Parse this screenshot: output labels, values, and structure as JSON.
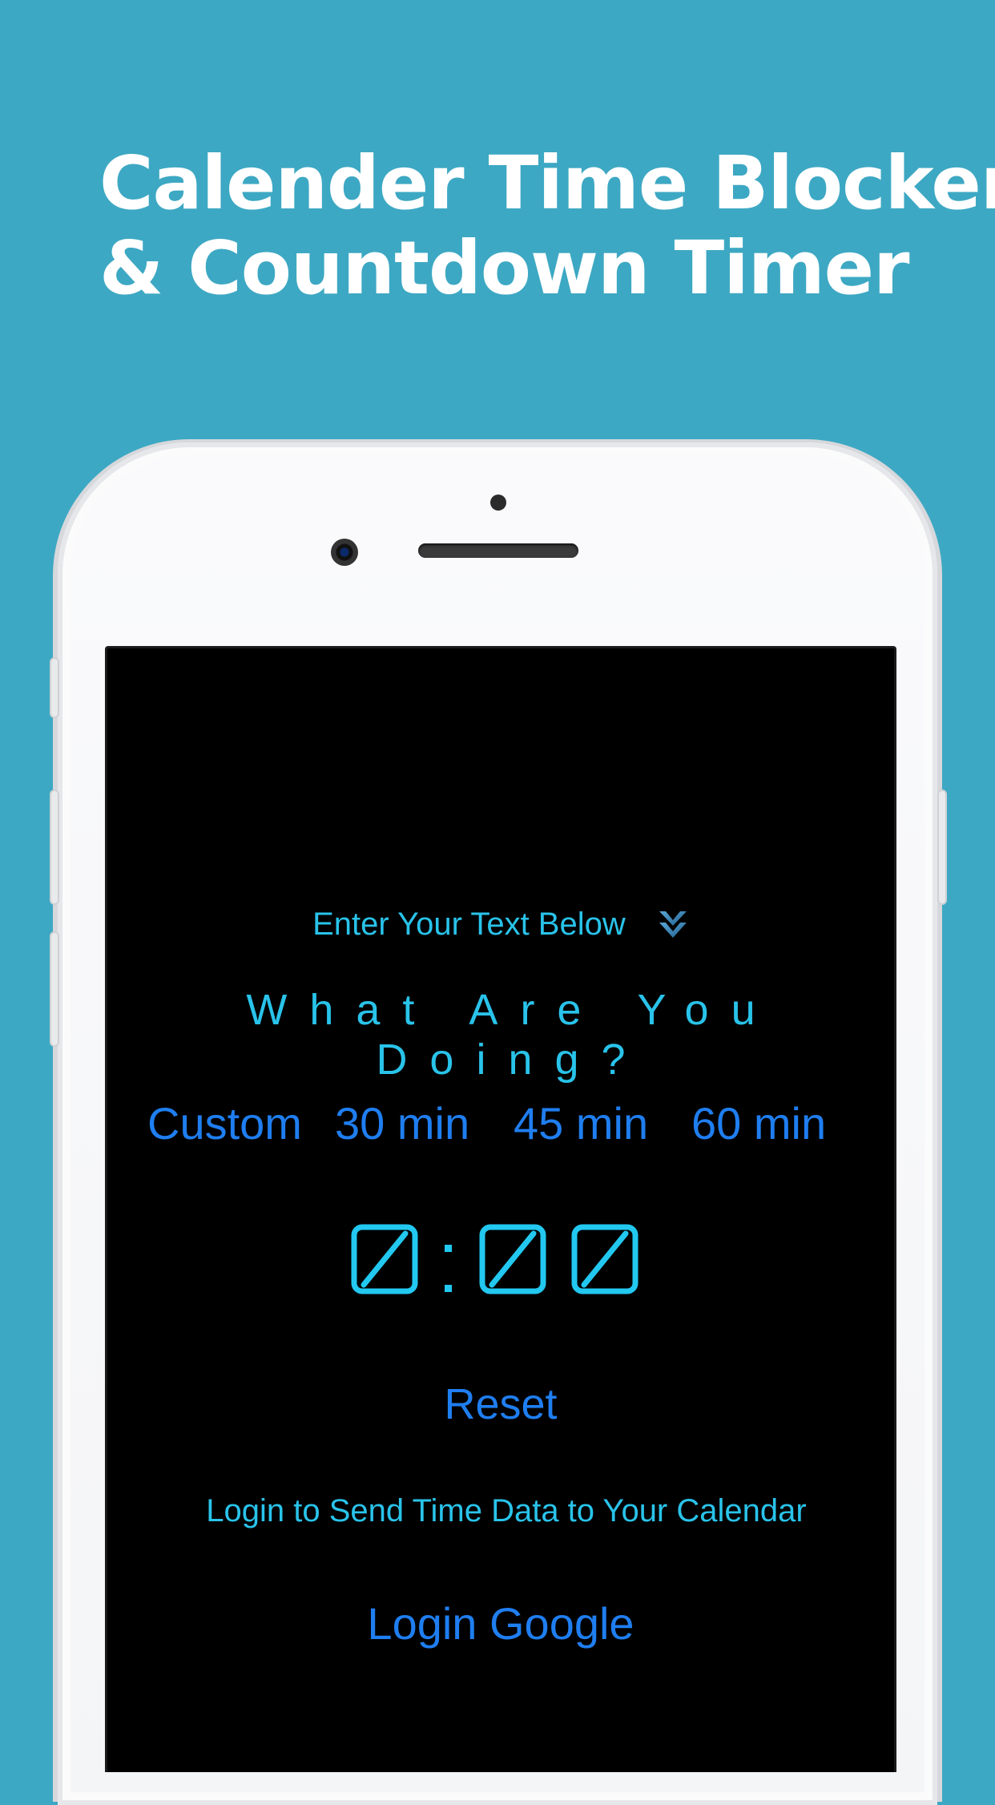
{
  "headline": {
    "line1": "Calender Time Blocker",
    "line2": "& Countdown Timer"
  },
  "colors": {
    "background": "#3da8c3",
    "accent_cyan": "#29c3ea",
    "accent_blue": "#1f7ef0",
    "screen": "#000000"
  },
  "app": {
    "prompt_label": "Enter Your Text Below",
    "prompt_icon": "chevron-double-down-icon",
    "input_placeholder": "What Are You Doing?",
    "presets": [
      "Custom",
      "30 min",
      "45 min",
      "60 min"
    ],
    "timer": {
      "minutes": "0",
      "separator": ":",
      "seconds": "00"
    },
    "reset_label": "Reset",
    "login_note": "Login to Send Time Data to Your Calendar",
    "login_label": "Login Google"
  }
}
